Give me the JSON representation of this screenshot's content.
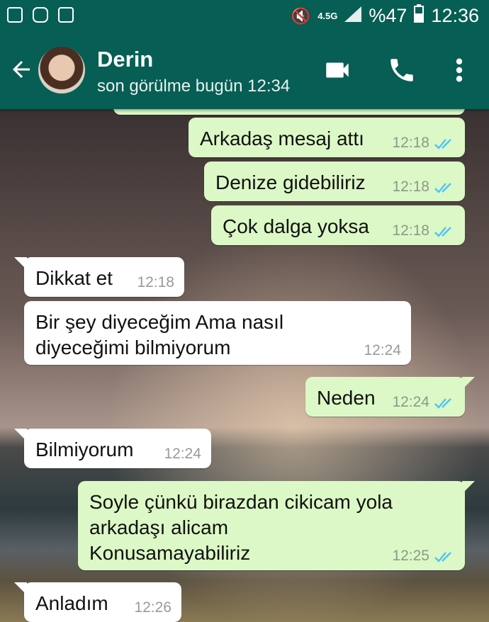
{
  "status_bar": {
    "network": "4.5G",
    "battery": "%47",
    "time": "12:36"
  },
  "header": {
    "contact_name": "Derin",
    "last_seen": "son görülme bugün 12:34",
    "icons": [
      "back-arrow-icon",
      "video-call-icon",
      "phone-icon",
      "more-vert-icon"
    ]
  },
  "messages": [
    {
      "dir": "out",
      "text": "Arkadaş mesaj attı",
      "time": "12:18",
      "read": true
    },
    {
      "dir": "out",
      "text": "Denize gidebiliriz",
      "time": "12:18",
      "read": true
    },
    {
      "dir": "out",
      "text": "Çok dalga yoksa",
      "time": "12:18",
      "read": true
    },
    {
      "dir": "in",
      "text": "Dikkat et",
      "time": "12:18"
    },
    {
      "dir": "in",
      "text": "Bir şey diyeceğim Ama nasıl\ndiyeceğimi bilmiyorum",
      "time": "12:24"
    },
    {
      "dir": "out",
      "text": "Neden",
      "time": "12:24",
      "read": true
    },
    {
      "dir": "in",
      "text": "Bilmiyorum",
      "time": "12:24"
    },
    {
      "dir": "out",
      "text": "Soyle çünkü birazdan cikicam yola\narkadaşı alicam\nKonusamayabiliriz",
      "time": "12:25",
      "read": true
    },
    {
      "dir": "in",
      "text": "Anladım",
      "time": "12:26"
    }
  ],
  "colors": {
    "header": "#075e54",
    "outgoing": "#dcf8c6",
    "incoming": "#ffffff",
    "read_tick": "#4fc3f7"
  }
}
